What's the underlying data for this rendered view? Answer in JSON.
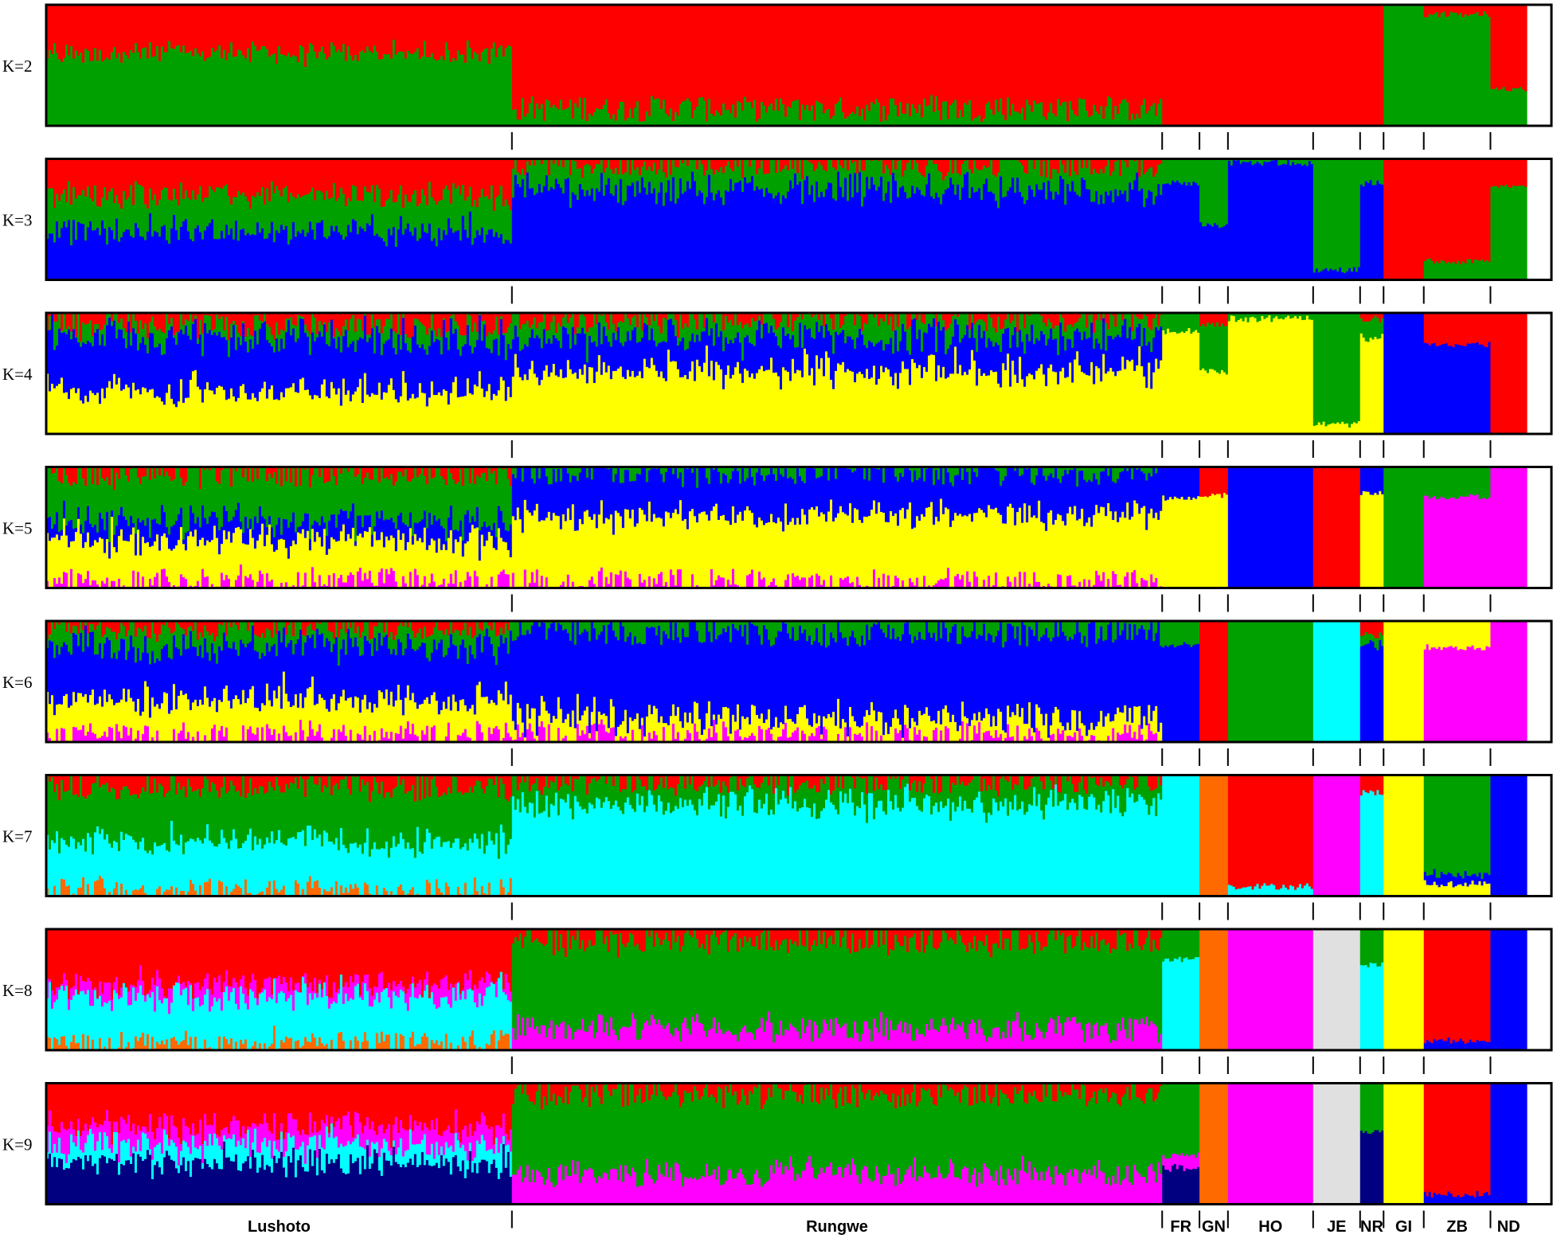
{
  "chart_data": {
    "type": "stacked-bar",
    "colors": {
      "red": "#ff0000",
      "green": "#00a000",
      "blue": "#0000ff",
      "yellow": "#ffff00",
      "magenta": "#ff00ff",
      "cyan": "#00ffff",
      "orange": "#ff6a00",
      "lightgray": "#e0e0e0",
      "navy": "#000080"
    },
    "populations": [
      {
        "label": "Lushoto",
        "share": 0.3094
      },
      {
        "label": "Rungwe",
        "share": 0.432
      },
      {
        "label": "FR",
        "share": 0.0248
      },
      {
        "label": "GN",
        "share": 0.0189
      },
      {
        "label": "HO",
        "share": 0.0566
      },
      {
        "label": "JE",
        "share": 0.0312
      },
      {
        "label": "NR",
        "share": 0.0156
      },
      {
        "label": "GI",
        "share": 0.0267
      },
      {
        "label": "ZB",
        "share": 0.0443
      },
      {
        "label": "ND",
        "share": 0.0241
      }
    ],
    "panels": [
      {
        "label": "K=2",
        "segments": [
          [
            [
              "red",
              0.4
            ],
            [
              "green",
              0.6
            ]
          ],
          [
            [
              "red",
              0.85
            ],
            [
              "green",
              0.15
            ]
          ],
          [
            [
              "red",
              1.0
            ]
          ],
          [
            [
              "red",
              1.0
            ]
          ],
          [
            [
              "red",
              1.0
            ]
          ],
          [
            [
              "red",
              1.0
            ]
          ],
          [
            [
              "red",
              1.0
            ]
          ],
          [
            [
              "green",
              1.0
            ]
          ],
          [
            [
              "red",
              0.08
            ],
            [
              "green",
              0.92
            ]
          ],
          [
            [
              "red",
              0.7
            ],
            [
              "green",
              0.3
            ]
          ]
        ]
      },
      {
        "label": "K=3",
        "segments": [
          [
            [
              "red",
              0.3
            ],
            [
              "green",
              0.3
            ],
            [
              "blue",
              0.4
            ]
          ],
          [
            [
              "red",
              0.05
            ],
            [
              "green",
              0.2
            ],
            [
              "blue",
              0.75
            ]
          ],
          [
            [
              "green",
              0.2
            ],
            [
              "blue",
              0.8
            ]
          ],
          [
            [
              "green",
              0.55
            ],
            [
              "blue",
              0.45
            ]
          ],
          [
            [
              "green",
              0.03
            ],
            [
              "blue",
              0.97
            ]
          ],
          [
            [
              "green",
              0.92
            ],
            [
              "blue",
              0.08
            ]
          ],
          [
            [
              "green",
              0.2
            ],
            [
              "blue",
              0.8
            ]
          ],
          [
            [
              "red",
              1.0
            ]
          ],
          [
            [
              "red",
              0.85
            ],
            [
              "green",
              0.15
            ]
          ],
          [
            [
              "red",
              0.22
            ],
            [
              "green",
              0.78
            ]
          ]
        ]
      },
      {
        "label": "K=4",
        "segments": [
          [
            [
              "red",
              0.1
            ],
            [
              "green",
              0.12
            ],
            [
              "blue",
              0.43
            ],
            [
              "yellow",
              0.35
            ]
          ],
          [
            [
              "red",
              0.05
            ],
            [
              "green",
              0.15
            ],
            [
              "blue",
              0.28
            ],
            [
              "yellow",
              0.52
            ]
          ],
          [
            [
              "green",
              0.15
            ],
            [
              "yellow",
              0.85
            ]
          ],
          [
            [
              "red",
              0.1
            ],
            [
              "green",
              0.38
            ],
            [
              "yellow",
              0.52
            ]
          ],
          [
            [
              "green",
              0.05
            ],
            [
              "yellow",
              0.95
            ]
          ],
          [
            [
              "green",
              0.92
            ],
            [
              "yellow",
              0.08
            ]
          ],
          [
            [
              "red",
              0.05
            ],
            [
              "green",
              0.15
            ],
            [
              "yellow",
              0.8
            ]
          ],
          [
            [
              "blue",
              1.0
            ]
          ],
          [
            [
              "red",
              0.26
            ],
            [
              "blue",
              0.74
            ]
          ],
          [
            [
              "red",
              1.0
            ]
          ]
        ]
      },
      {
        "label": "K=5",
        "segments": [
          [
            [
              "red",
              0.05
            ],
            [
              "green",
              0.4
            ],
            [
              "blue",
              0.15
            ],
            [
              "yellow",
              0.35
            ],
            [
              "magenta",
              0.05
            ]
          ],
          [
            [
              "green",
              0.05
            ],
            [
              "blue",
              0.35
            ],
            [
              "yellow",
              0.55
            ],
            [
              "magenta",
              0.05
            ]
          ],
          [
            [
              "blue",
              0.25
            ],
            [
              "yellow",
              0.75
            ]
          ],
          [
            [
              "red",
              0.23
            ],
            [
              "yellow",
              0.77
            ]
          ],
          [
            [
              "blue",
              1.0
            ]
          ],
          [
            [
              "red",
              1.0
            ]
          ],
          [
            [
              "blue",
              0.22
            ],
            [
              "yellow",
              0.78
            ]
          ],
          [
            [
              "green",
              1.0
            ]
          ],
          [
            [
              "green",
              0.25
            ],
            [
              "magenta",
              0.75
            ]
          ],
          [
            [
              "magenta",
              1.0
            ]
          ]
        ]
      },
      {
        "label": "K=6",
        "segments": [
          [
            [
              "red",
              0.05
            ],
            [
              "green",
              0.15
            ],
            [
              "blue",
              0.45
            ],
            [
              "yellow",
              0.3
            ],
            [
              "magenta",
              0.05
            ]
          ],
          [
            [
              "green",
              0.1
            ],
            [
              "blue",
              0.7
            ],
            [
              "yellow",
              0.15
            ],
            [
              "magenta",
              0.05
            ]
          ],
          [
            [
              "green",
              0.2
            ],
            [
              "blue",
              0.8
            ]
          ],
          [
            [
              "red",
              1.0
            ]
          ],
          [
            [
              "green",
              1.0
            ]
          ],
          [
            [
              "cyan",
              1.0
            ]
          ],
          [
            [
              "red",
              0.12
            ],
            [
              "green",
              0.08
            ],
            [
              "blue",
              0.8
            ]
          ],
          [
            [
              "yellow",
              1.0
            ]
          ],
          [
            [
              "yellow",
              0.22
            ],
            [
              "magenta",
              0.78
            ]
          ],
          [
            [
              "magenta",
              1.0
            ]
          ]
        ]
      },
      {
        "label": "K=7",
        "segments": [
          [
            [
              "red",
              0.1
            ],
            [
              "green",
              0.45
            ],
            [
              "cyan",
              0.4
            ],
            [
              "orange",
              0.05
            ]
          ],
          [
            [
              "red",
              0.05
            ],
            [
              "green",
              0.18
            ],
            [
              "cyan",
              0.77
            ]
          ],
          [
            [
              "cyan",
              1.0
            ]
          ],
          [
            [
              "orange",
              1.0
            ]
          ],
          [
            [
              "red",
              0.92
            ],
            [
              "cyan",
              0.08
            ]
          ],
          [
            [
              "magenta",
              1.0
            ]
          ],
          [
            [
              "red",
              0.15
            ],
            [
              "cyan",
              0.85
            ]
          ],
          [
            [
              "yellow",
              1.0
            ]
          ],
          [
            [
              "green",
              0.82
            ],
            [
              "blue",
              0.08
            ],
            [
              "yellow",
              0.1
            ]
          ],
          [
            [
              "blue",
              1.0
            ]
          ]
        ]
      },
      {
        "label": "K=8",
        "segments": [
          [
            [
              "red",
              0.45
            ],
            [
              "magenta",
              0.1
            ],
            [
              "cyan",
              0.4
            ],
            [
              "orange",
              0.05
            ]
          ],
          [
            [
              "red",
              0.1
            ],
            [
              "green",
              0.72
            ],
            [
              "magenta",
              0.18
            ]
          ],
          [
            [
              "green",
              0.25
            ],
            [
              "cyan",
              0.75
            ]
          ],
          [
            [
              "orange",
              1.0
            ]
          ],
          [
            [
              "magenta",
              1.0
            ]
          ],
          [
            [
              "lightgray",
              1.0
            ]
          ],
          [
            [
              "green",
              0.3
            ],
            [
              "cyan",
              0.7
            ]
          ],
          [
            [
              "yellow",
              1.0
            ]
          ],
          [
            [
              "red",
              0.92
            ],
            [
              "blue",
              0.08
            ]
          ],
          [
            [
              "blue",
              1.0
            ]
          ]
        ]
      },
      {
        "label": "K=9",
        "segments": [
          [
            [
              "red",
              0.35
            ],
            [
              "magenta",
              0.15
            ],
            [
              "cyan",
              0.15
            ],
            [
              "navy",
              0.35
            ]
          ],
          [
            [
              "red",
              0.1
            ],
            [
              "green",
              0.65
            ],
            [
              "magenta",
              0.25
            ]
          ],
          [
            [
              "green",
              0.6
            ],
            [
              "magenta",
              0.1
            ],
            [
              "navy",
              0.3
            ]
          ],
          [
            [
              "orange",
              1.0
            ]
          ],
          [
            [
              "magenta",
              1.0
            ]
          ],
          [
            [
              "lightgray",
              1.0
            ]
          ],
          [
            [
              "green",
              0.4
            ],
            [
              "navy",
              0.6
            ]
          ],
          [
            [
              "yellow",
              1.0
            ]
          ],
          [
            [
              "red",
              0.92
            ],
            [
              "blue",
              0.08
            ]
          ],
          [
            [
              "blue",
              1.0
            ]
          ]
        ]
      }
    ]
  }
}
